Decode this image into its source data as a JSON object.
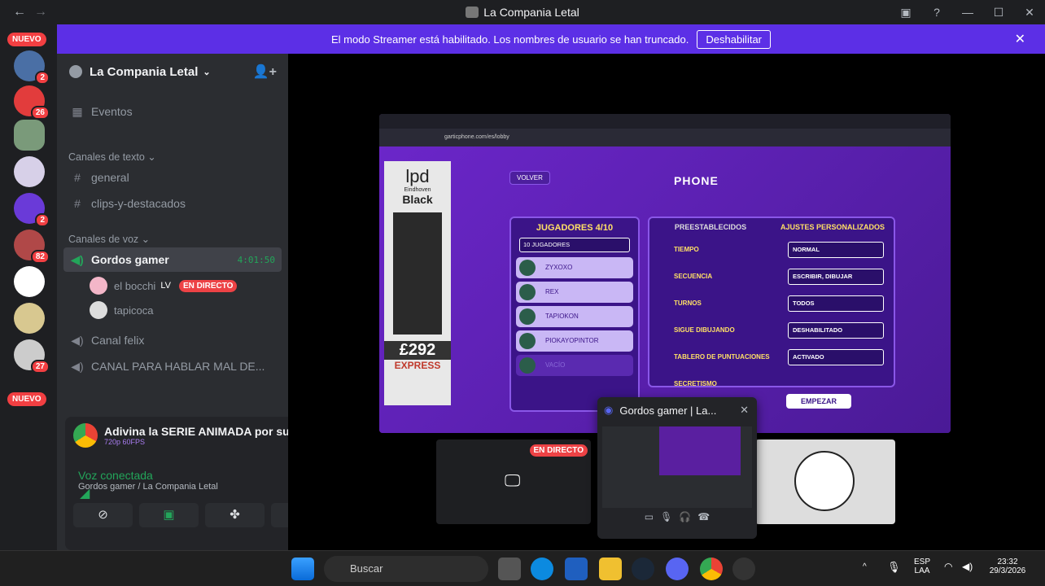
{
  "window": {
    "title": "La Compania Letal"
  },
  "banner": {
    "text": "El modo Streamer está habilitado. Los nombres de usuario se han truncado.",
    "button": "Deshabilitar"
  },
  "guilds": {
    "new_label": "NUEVO",
    "badges": [
      "2",
      "26",
      "2",
      "82",
      "27"
    ]
  },
  "server": {
    "name": "La Compania Letal"
  },
  "channels": {
    "events": "Eventos",
    "text_category": "Canales de texto",
    "text": [
      "general",
      "clips-y-destacados"
    ],
    "voice_category": "Canales de voz",
    "voice_active": {
      "name": "Gordos gamer",
      "timer": "4:01:50"
    },
    "voice_users": [
      {
        "name": "el bocchi",
        "tag": "LV",
        "live": "EN DIRECTO"
      },
      {
        "name": "tapicoca"
      }
    ],
    "voice_other": [
      "Canal felix",
      "CANAL PARA HABLAR MAL DE..."
    ]
  },
  "panel": {
    "activity_title": "Adivina la SERIE ANIMADA por su i...",
    "activity_sub": "720p 60FPS",
    "voice_status": "Voz conectada",
    "voice_location": "Gordos gamer / La Compania Letal"
  },
  "stream": {
    "browser_url": "garticphone.com/es/lobby",
    "ad": {
      "brand": "lpd",
      "city": "Eindhoven",
      "color": "Black",
      "price": "£292",
      "store": "EXPRESS"
    },
    "game": {
      "back": "VOLVER",
      "logo": "PHONE",
      "players_title": "JUGADORES 4/10",
      "players_select": "10 JUGADORES",
      "players": [
        "ZYXOXO",
        "REX",
        "TAPIOKON",
        "PIOKAYOPINTOR",
        "VACÍO",
        "VACÍO"
      ],
      "tab_presets": "PREESTABLECIDOS",
      "tab_custom": "AJUSTES PERSONALIZADOS",
      "settings": [
        {
          "name": "TIEMPO",
          "value": "NORMAL"
        },
        {
          "name": "SECUENCIA",
          "value": "ESCRIBIR, DIBUJAR"
        },
        {
          "name": "TURNOS",
          "value": "TODOS"
        },
        {
          "name": "SIGUE DIBUJANDO",
          "value": "DESHABILITADO"
        },
        {
          "name": "TABLERO DE PUNTUACIONES",
          "value": "ACTIVADO"
        },
        {
          "name": "SECRETISMO",
          "value": ""
        }
      ],
      "start": "EMPEZAR"
    },
    "live_tag": "EN DIRECTO"
  },
  "popup": {
    "title": "Gordos gamer | La..."
  },
  "taskbar": {
    "search": "Buscar",
    "lang1": "ESP",
    "lang2": "LAA",
    "time": "23:32",
    "date": "29/3/2026"
  }
}
